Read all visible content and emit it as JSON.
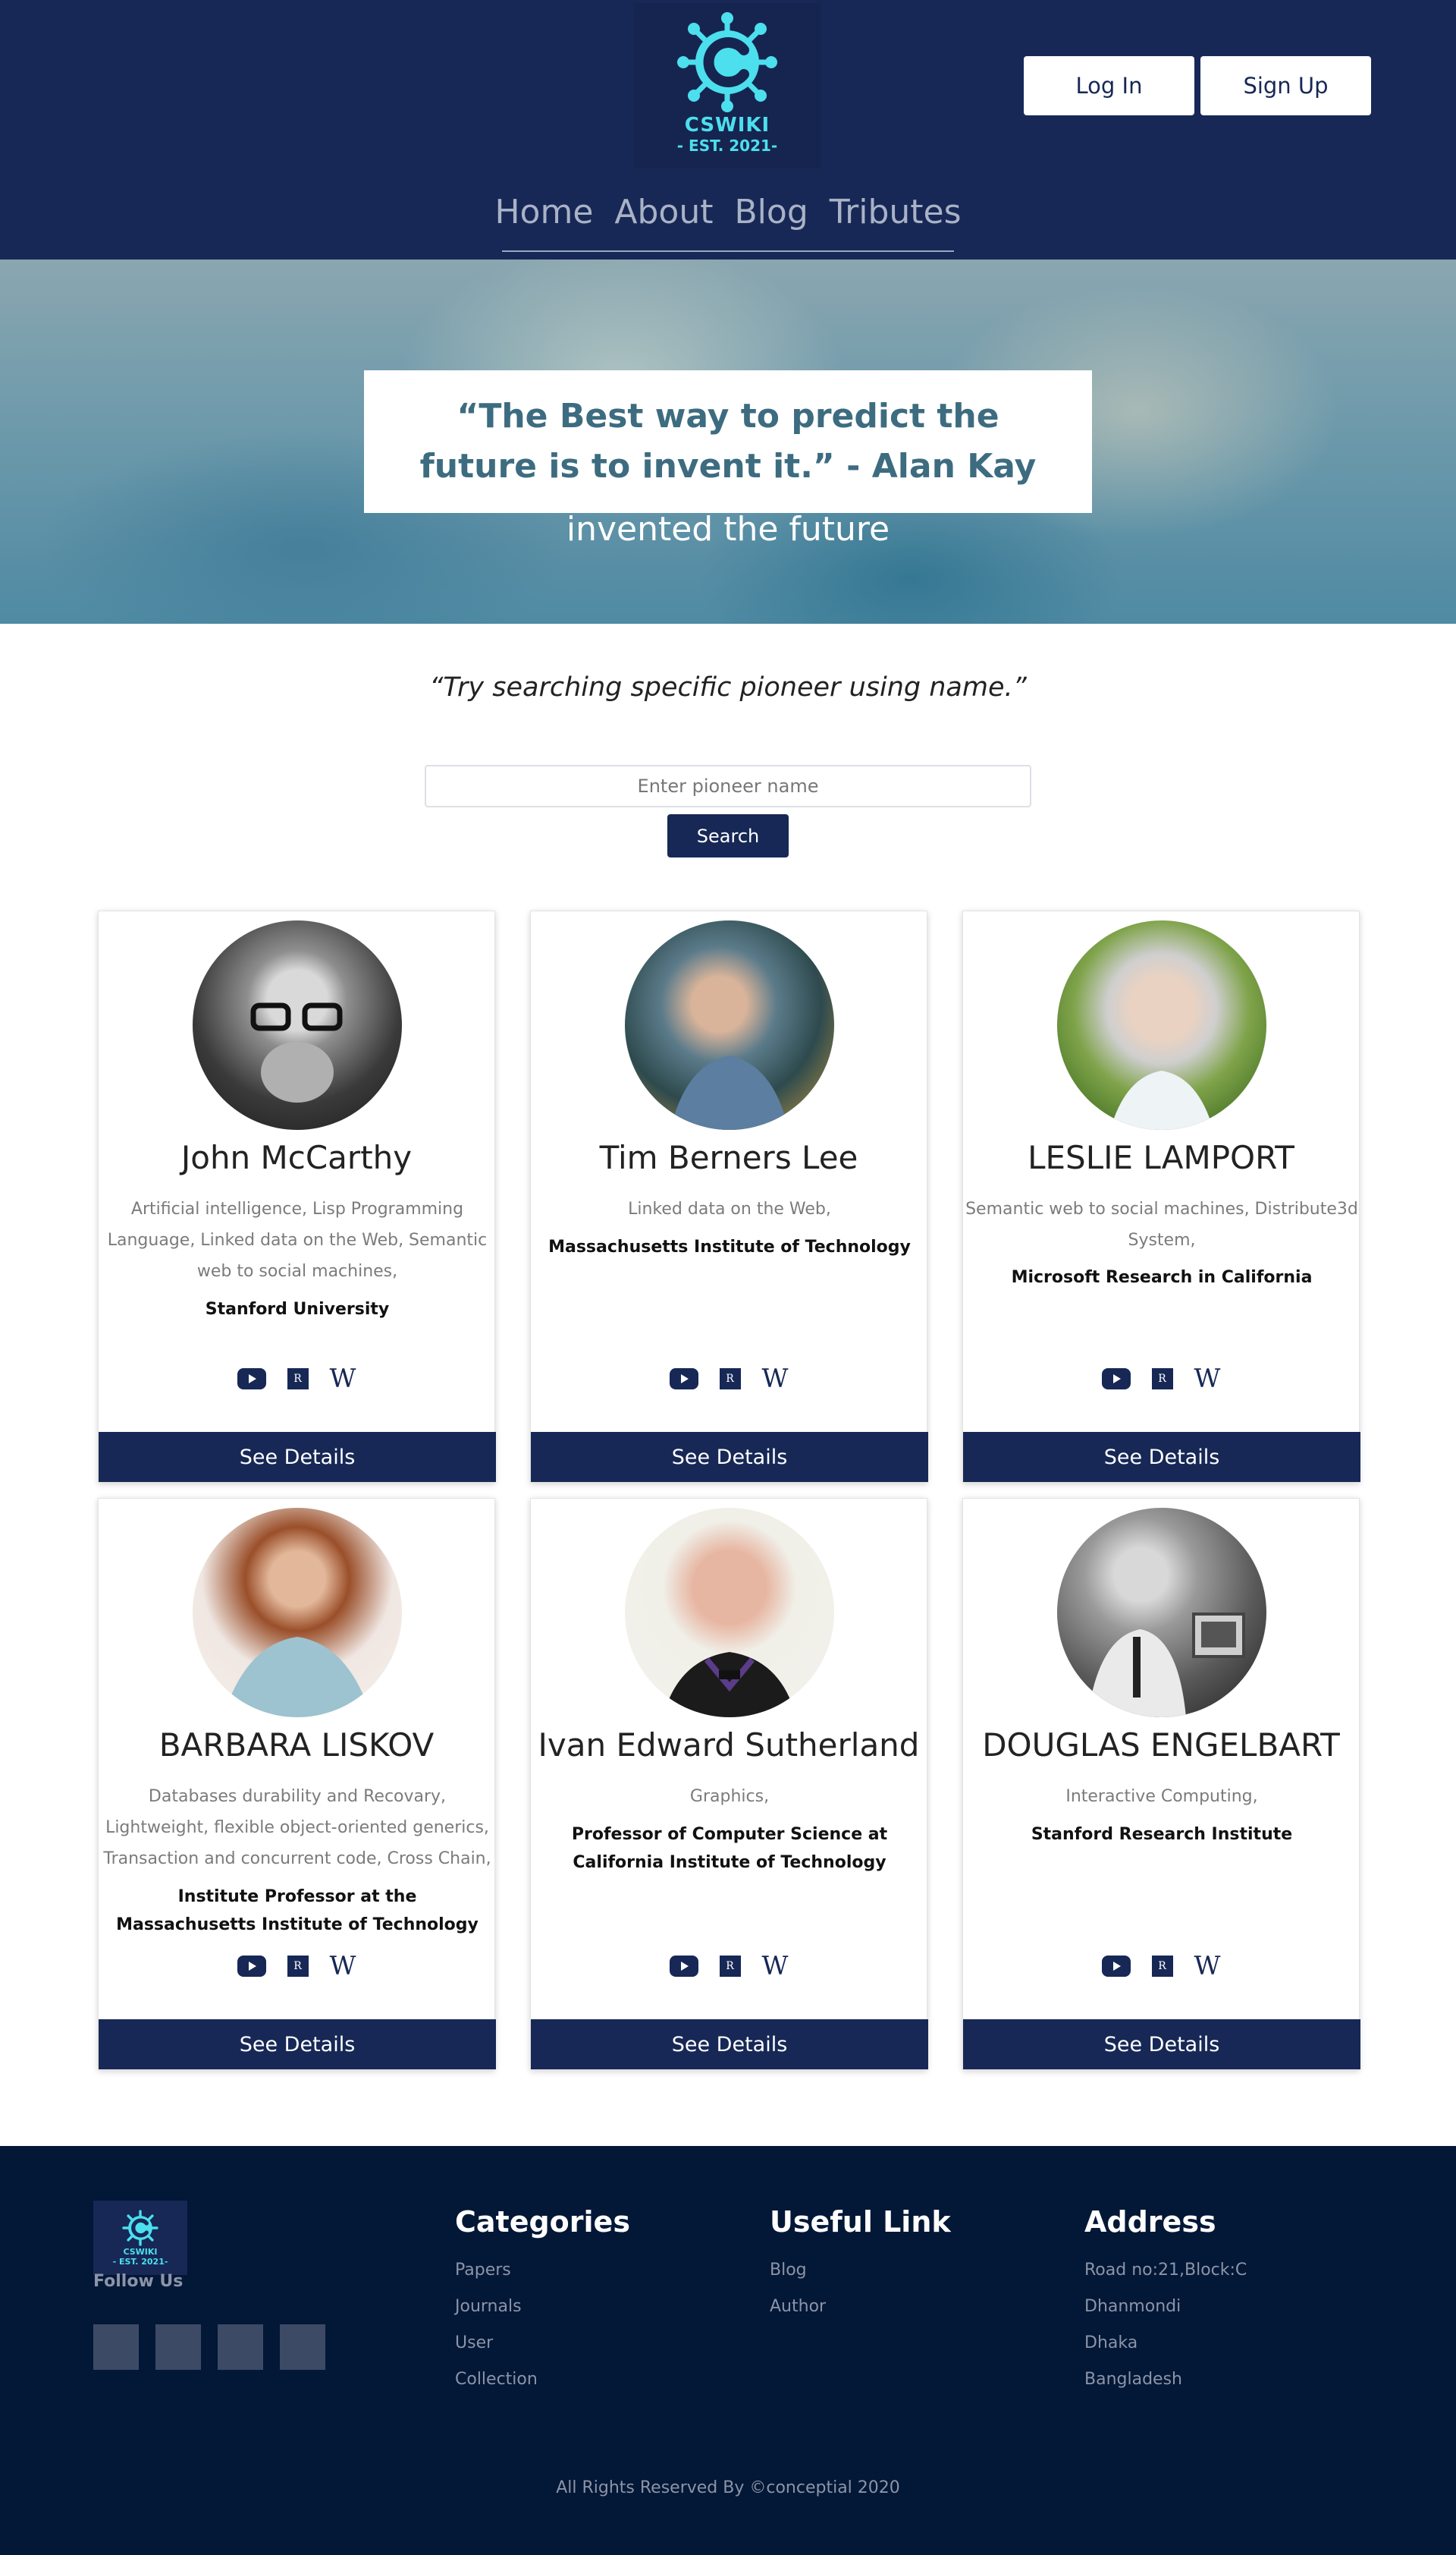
{
  "header": {
    "logo_text": "CSWIKI",
    "logo_est": "- EST. 2021-",
    "login_label": "Log In",
    "signup_label": "Sign Up",
    "nav": [
      "Home",
      "About",
      "Blog",
      "Tributes"
    ]
  },
  "hero": {
    "quote": "“The Best way to predict the future is to invent it.” - Alan Kay",
    "subtitle": "invented the future"
  },
  "search": {
    "hint": "“Try searching specific pioneer using name.”",
    "placeholder": "Enter pioneer name",
    "button_label": "Search"
  },
  "cards": [
    {
      "name": "John McCarthy",
      "fields": "Artificial intelligence, Lisp Programming Language, Linked data on the Web, Semantic web to social machines,",
      "institution": "Stanford University",
      "button": "See Details"
    },
    {
      "name": "Tim Berners Lee",
      "fields": "Linked data on the Web,",
      "institution": "Massachusetts Institute of Technology",
      "button": "See Details"
    },
    {
      "name": "LESLIE LAMPORT",
      "fields": "Semantic web to social machines, Distribute3d System,",
      "institution": "Microsoft Research in California",
      "button": "See Details"
    },
    {
      "name": "BARBARA LISKOV",
      "fields": "Databases durability and Recovary, Lightweight, flexible object-oriented generics, Transaction and concurrent code, Cross Chain,",
      "institution": "Institute Professor at the Massachusetts Institute of Technology",
      "button": "See Details"
    },
    {
      "name": "Ivan Edward Sutherland",
      "fields": "Graphics,",
      "institution": "Professor of Computer Science at California Institute of Technology",
      "button": "See Details"
    },
    {
      "name": "DOUGLAS ENGELBART",
      "fields": "Interactive Computing,",
      "institution": "Stanford Research Institute",
      "button": "See Details"
    }
  ],
  "card_icons": [
    "youtube-icon",
    "researchgate-icon",
    "wikipedia-icon"
  ],
  "icon_glyphs": {
    "researchgate": "R",
    "wikipedia": "W"
  },
  "footer": {
    "logo_text": "CSWIKI",
    "logo_est": "- EST. 2021-",
    "follow_label": "Follow Us",
    "categories": {
      "title": "Categories",
      "items": [
        "Papers",
        "Journals",
        "User",
        "Collection"
      ]
    },
    "useful": {
      "title": "Useful Link",
      "items": [
        "Blog",
        "Author"
      ]
    },
    "address": {
      "title": "Address",
      "items": [
        "Road no:21,Block:C",
        "Dhanmondi",
        "Dhaka",
        "Bangladesh"
      ]
    },
    "copyright": "All Rights Reserved By ©conceptial 2020"
  },
  "colors": {
    "navy": "#172856",
    "accent": "#4cdfee",
    "footer_bg": "#031736"
  }
}
